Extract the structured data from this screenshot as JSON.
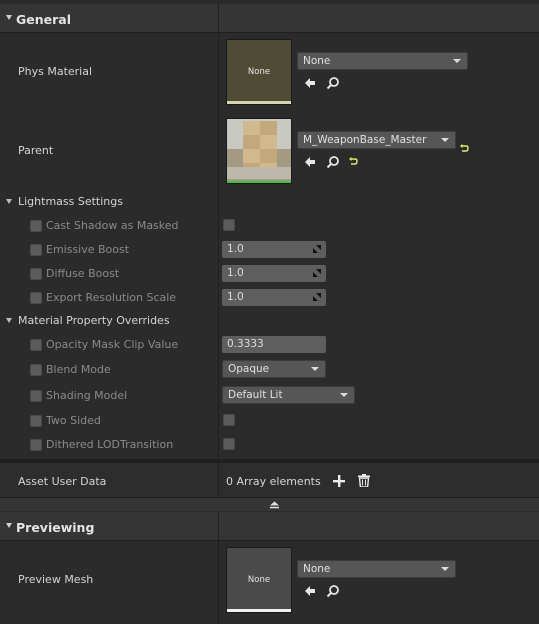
{
  "general": {
    "title": "General",
    "phys_material": {
      "label": "Phys Material",
      "thumb_text": "None",
      "combo_value": "None"
    },
    "parent": {
      "label": "Parent",
      "combo_value": "M_WeaponBase_Master"
    }
  },
  "lightmass": {
    "title": "Lightmass Settings",
    "rows": [
      {
        "label": "Cast Shadow as Masked"
      },
      {
        "label": "Emissive Boost",
        "value": "1.0"
      },
      {
        "label": "Diffuse Boost",
        "value": "1.0"
      },
      {
        "label": "Export Resolution Scale",
        "value": "1.0"
      }
    ]
  },
  "material_overrides": {
    "title": "Material Property Overrides",
    "rows": [
      {
        "label": "Opacity Mask Clip Value",
        "value": "0.3333"
      },
      {
        "label": "Blend Mode",
        "value": "Opaque"
      },
      {
        "label": "Shading Model",
        "value": "Default Lit"
      },
      {
        "label": "Two Sided"
      },
      {
        "label": "Dithered LODTransition"
      }
    ]
  },
  "asset_user_data": {
    "label": "Asset User Data",
    "value": "0 Array elements"
  },
  "previewing": {
    "title": "Previewing",
    "preview_mesh": {
      "label": "Preview Mesh",
      "thumb_text": "None",
      "combo_value": "None"
    }
  },
  "colors": {
    "background": "#2b2b2b",
    "header": "#353535",
    "phys_thumb": "#4f4b35",
    "preview_thumb": "#4a4a4a",
    "parent_underline": "#3cc43c",
    "reset_yellow": "#e8e86a"
  }
}
